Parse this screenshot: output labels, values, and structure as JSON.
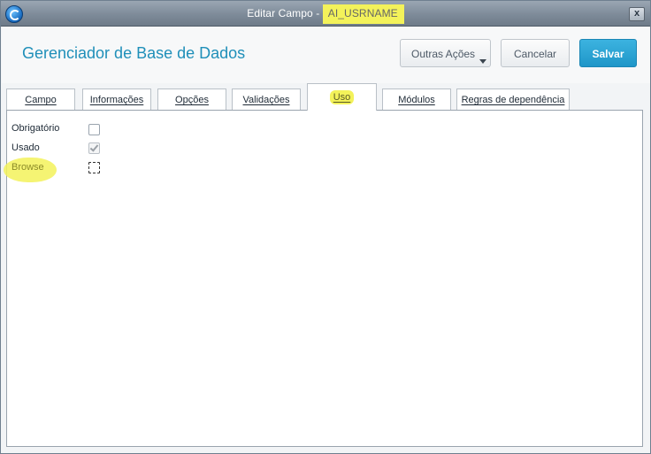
{
  "window": {
    "title_prefix": "Editar Campo - ",
    "field_name": "AI_USRNAME",
    "close_label": "x"
  },
  "header": {
    "title": "Gerenciador de Base de Dados",
    "more_actions_label": "Outras Ações",
    "cancel_label": "Cancelar",
    "save_label": "Salvar"
  },
  "tabs": [
    {
      "label": "Campo"
    },
    {
      "label": "Informações"
    },
    {
      "label": "Opções"
    },
    {
      "label": "Validações"
    },
    {
      "label": "Uso",
      "active": true
    },
    {
      "label": "Módulos"
    },
    {
      "label": "Regras de dependência"
    }
  ],
  "usage": {
    "fields": [
      {
        "label": "Obrigatório",
        "checked": false,
        "disabled": false
      },
      {
        "label": "Usado",
        "checked": true,
        "disabled": true
      },
      {
        "label": "Browse",
        "checked": false,
        "focused": true,
        "highlighted": true
      }
    ]
  },
  "colors": {
    "accent": "#1f8fb9",
    "save_button": "#2aa4d6",
    "highlight": "#f3f25a"
  }
}
